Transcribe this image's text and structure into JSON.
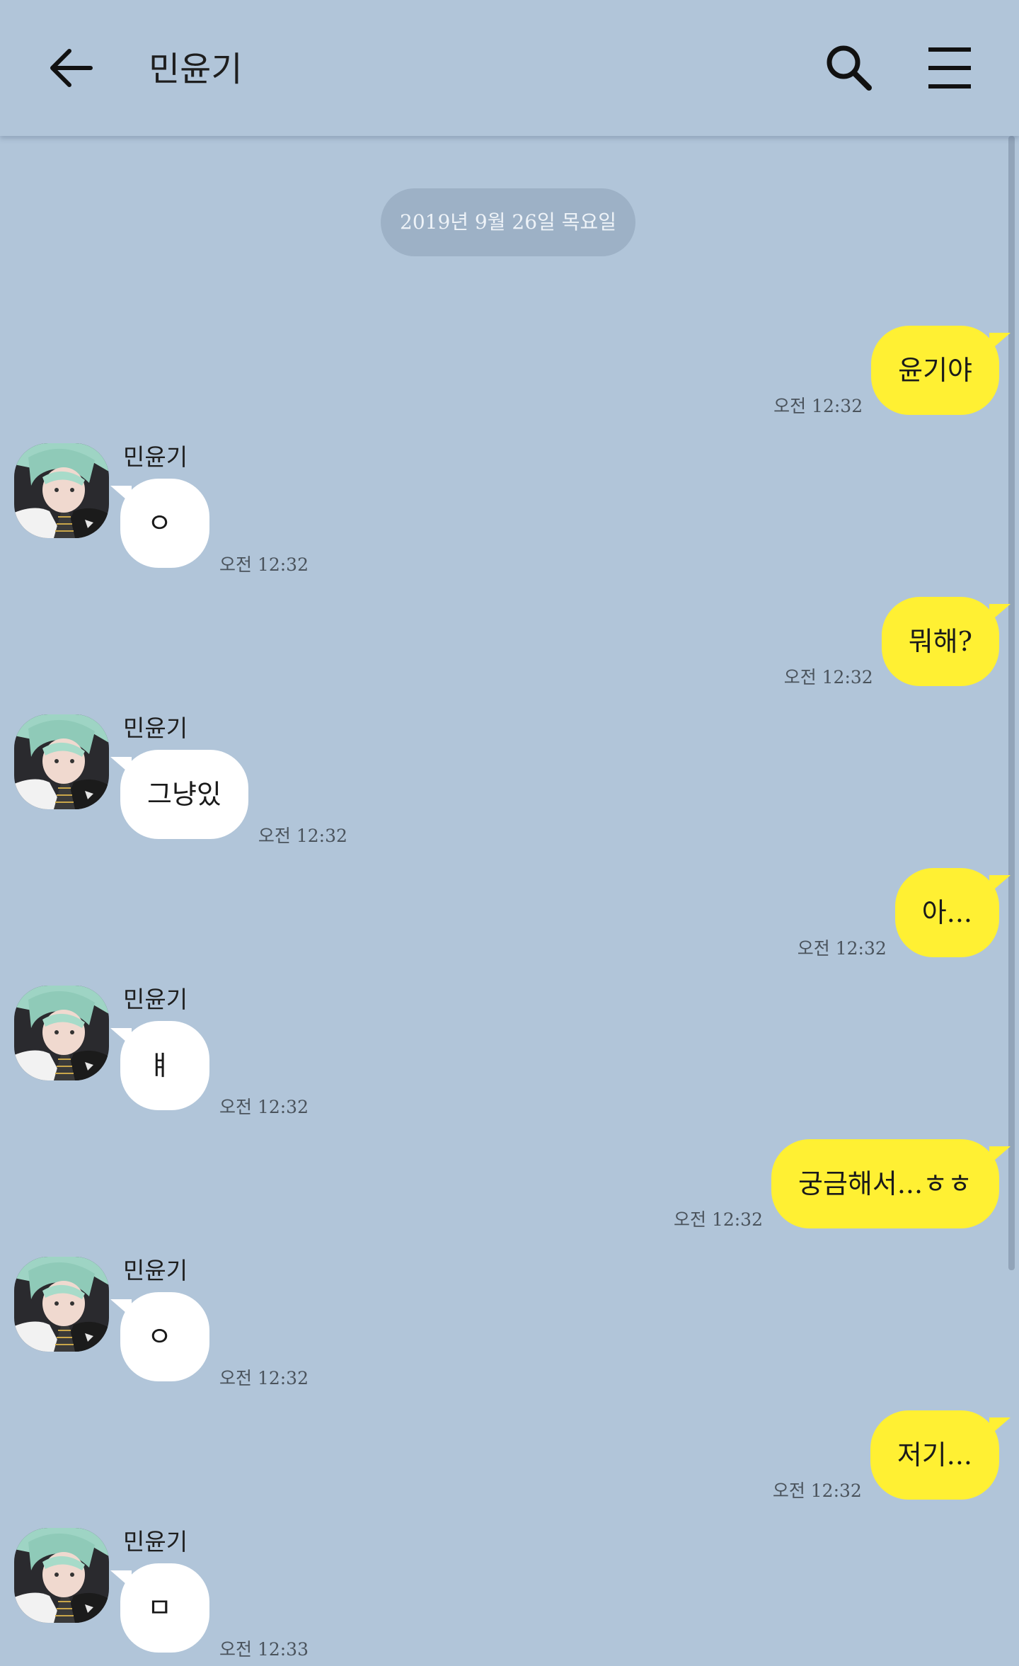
{
  "header": {
    "title": "민윤기",
    "back_icon": "arrow-left-icon",
    "search_icon": "search-icon",
    "menu_icon": "hamburger-menu-icon"
  },
  "date_divider": "2019년 9월 26일 목요일",
  "colors": {
    "background": "#b1c5d9",
    "outgoing_bubble": "#fff033",
    "incoming_bubble": "#ffffff",
    "date_pill": "#9db1c6"
  },
  "messages": [
    {
      "dir": "out",
      "text": "윤기야",
      "time": "오전 12:32"
    },
    {
      "dir": "in",
      "sender": "민윤기",
      "text": "ㅇ",
      "time": "오전 12:32"
    },
    {
      "dir": "out",
      "text": "뭐해?",
      "time": "오전 12:32"
    },
    {
      "dir": "in",
      "sender": "민윤기",
      "text": "그냥있",
      "time": "오전 12:32"
    },
    {
      "dir": "out",
      "text": "아...",
      "time": "오전 12:32"
    },
    {
      "dir": "in",
      "sender": "민윤기",
      "text": "ㅒ",
      "time": "오전 12:32"
    },
    {
      "dir": "out",
      "text": "궁금해서...ㅎㅎ",
      "time": "오전 12:32"
    },
    {
      "dir": "in",
      "sender": "민윤기",
      "text": "ㅇ",
      "time": "오전 12:32"
    },
    {
      "dir": "out",
      "text": "저기...",
      "time": "오전 12:32"
    },
    {
      "dir": "in",
      "sender": "민윤기",
      "text": "ㅁ",
      "time": "오전 12:33"
    }
  ]
}
